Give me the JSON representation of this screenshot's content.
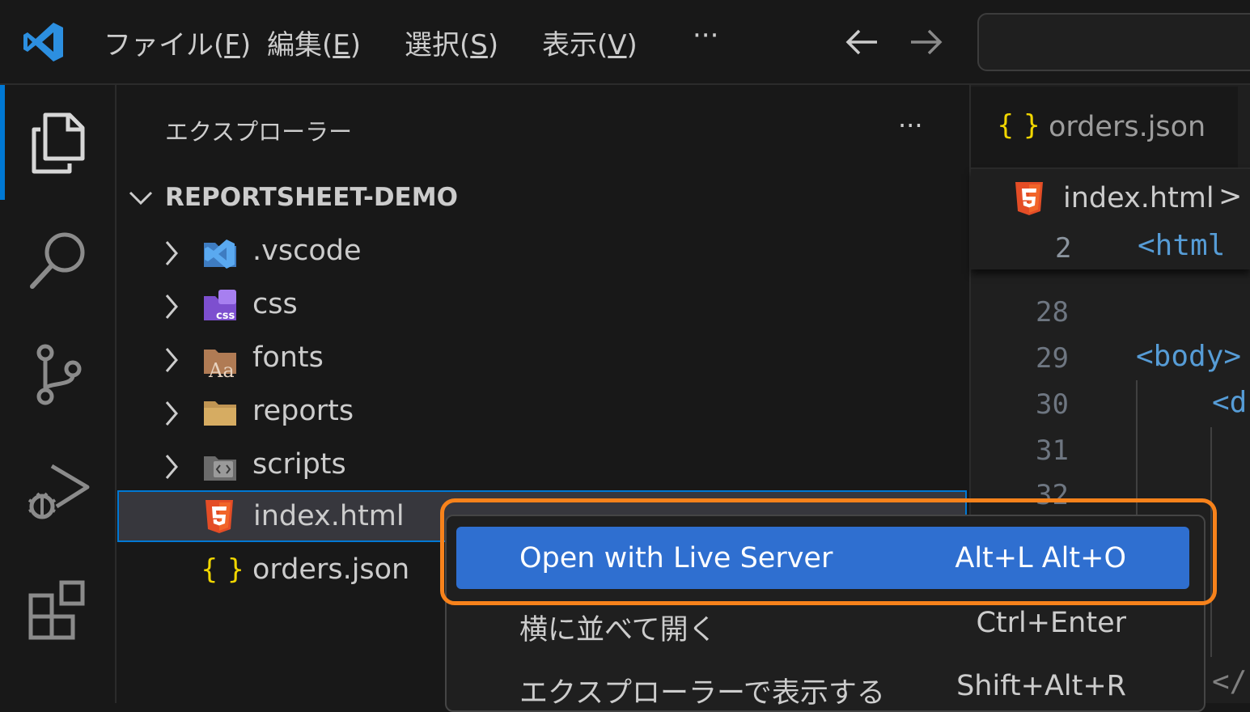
{
  "titlebar": {
    "menus": [
      {
        "label": "ファイル(",
        "key": "F",
        "end": ")"
      },
      {
        "label": "編集(",
        "key": "E",
        "end": ")"
      },
      {
        "label": "選択(",
        "key": "S",
        "end": ")"
      },
      {
        "label": "表示(",
        "key": "V",
        "end": ")"
      }
    ],
    "more": "···"
  },
  "sidebar": {
    "title": "エクスプローラー",
    "more": "···",
    "root": "REPORTSHEET-DEMO",
    "items": [
      {
        "label": ".vscode",
        "icon": "vscode-folder-icon",
        "type": "folder"
      },
      {
        "label": "css",
        "icon": "css-folder-icon",
        "type": "folder",
        "badge": "css"
      },
      {
        "label": "fonts",
        "icon": "fonts-folder-icon",
        "type": "folder",
        "badge": "Aa"
      },
      {
        "label": "reports",
        "icon": "folder-icon",
        "type": "folder"
      },
      {
        "label": "scripts",
        "icon": "scripts-folder-icon",
        "type": "folder"
      },
      {
        "label": "index.html",
        "icon": "html5-icon",
        "type": "file",
        "selected": true
      },
      {
        "label": "orders.json",
        "icon": "json-braces-icon",
        "type": "file",
        "glyph": "{ }"
      }
    ]
  },
  "editor": {
    "tab": {
      "label": "orders.json",
      "glyph": "{ }"
    },
    "breadcrumb": {
      "label": "index.html",
      "sep": ">"
    },
    "sticky": {
      "line": "2",
      "code": "<html"
    },
    "lines": [
      {
        "n": "28",
        "code": ""
      },
      {
        "n": "29",
        "code": "<body>"
      },
      {
        "n": "30",
        "code": "<d"
      },
      {
        "n": "31",
        "code": ""
      },
      {
        "n": "32",
        "code": ""
      }
    ],
    "closing_fragment": "</"
  },
  "context_menu": {
    "items": [
      {
        "label": "Open with Live Server",
        "shortcut": "Alt+L Alt+O",
        "highlighted": true
      },
      {
        "label": "横に並べて開く",
        "shortcut": "Ctrl+Enter"
      },
      {
        "label": "エクスプローラーで表示する",
        "shortcut": "Shift+Alt+R"
      }
    ]
  },
  "colors": {
    "accent": "#0078d4",
    "menu_highlight": "#2f6fd0",
    "annotation": "#f7821b",
    "html5": "#e44d26",
    "json": "#f1d600"
  }
}
